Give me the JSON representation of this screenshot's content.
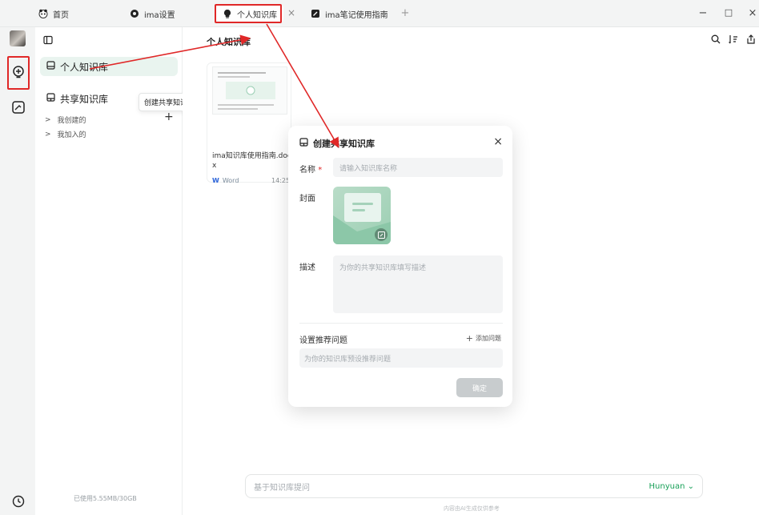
{
  "tabs": [
    {
      "label": "首页",
      "icon": "panda-icon"
    },
    {
      "label": "ima设置",
      "icon": "gear-icon"
    },
    {
      "label": "个人知识库",
      "icon": "bulb-icon"
    },
    {
      "label": "ima笔记使用指南",
      "icon": "note-icon"
    }
  ],
  "window": {
    "minimize": "−",
    "maximize": "□",
    "close": "×",
    "tab_close": "×",
    "new_tab": "+"
  },
  "sidebar": {
    "personal_kb": "个人知识库",
    "shared_kb": "共享知识库",
    "tooltip": "创建共享知识库",
    "add": "+",
    "sub_items": [
      {
        "arrow": ">",
        "label": "我创建的"
      },
      {
        "arrow": ">",
        "label": "我加入的"
      }
    ],
    "storage": "已使用5.55MB/30GB"
  },
  "main": {
    "title": "个人知识库",
    "doc": {
      "name": "ima知识库使用指南.docx",
      "type": "Word",
      "time": "14:25"
    },
    "ask_placeholder": "基于知识库提问",
    "model": "Hunyuan",
    "model_chevron": "⌄",
    "footnote": "内容由AI生成仅供参考"
  },
  "modal": {
    "title": "创建共享知识库",
    "close": "×",
    "name_label": "名称",
    "required_mark": "*",
    "name_placeholder": "请输入知识库名称",
    "cover_label": "封面",
    "desc_label": "描述",
    "desc_placeholder": "为你的共享知识库填写描述",
    "questions_label": "设置推荐问题",
    "add_question_plus": "+",
    "add_question": "添加问题",
    "question_placeholder": "为你的知识库预设推荐问题",
    "confirm": "确定"
  },
  "colors": {
    "accent": "#18a058",
    "highlight": "#e02828",
    "active_bg": "#e9f4ef"
  }
}
